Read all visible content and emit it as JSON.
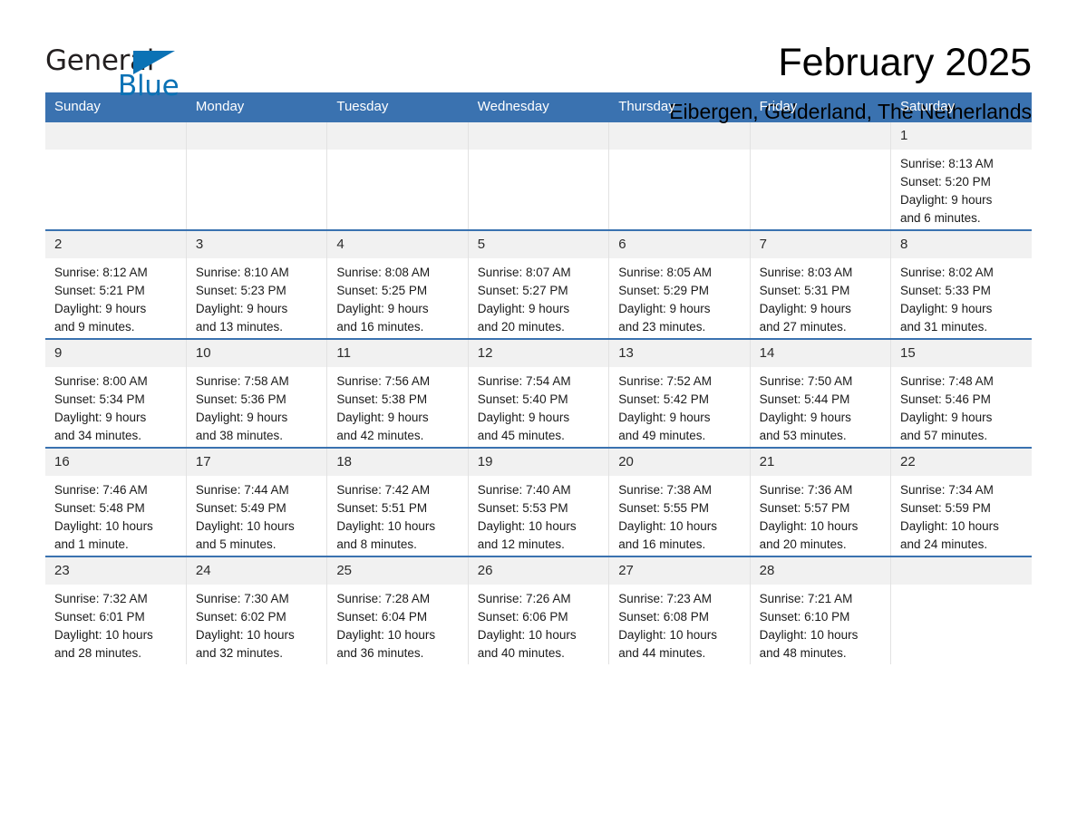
{
  "logo": {
    "word_one": "General",
    "word_two": "Blue",
    "triangle_icon": "triangle-icon",
    "brand_black": "#231f20",
    "brand_blue": "#0b72b5"
  },
  "header": {
    "title": "February 2025",
    "subtitle": "Eibergen, Gelderland, The Netherlands"
  },
  "theme": {
    "header_bg": "#3a72b0",
    "daynum_bg": "#f1f1f1",
    "row_rule": "#3a72b0",
    "cell_divider": "#e2e2e2"
  },
  "calendar": {
    "weekday_headers": [
      "Sunday",
      "Monday",
      "Tuesday",
      "Wednesday",
      "Thursday",
      "Friday",
      "Saturday"
    ],
    "weeks": [
      [
        {
          "day": "",
          "lines": []
        },
        {
          "day": "",
          "lines": []
        },
        {
          "day": "",
          "lines": []
        },
        {
          "day": "",
          "lines": []
        },
        {
          "day": "",
          "lines": []
        },
        {
          "day": "",
          "lines": []
        },
        {
          "day": "1",
          "lines": [
            "Sunrise: 8:13 AM",
            "Sunset: 5:20 PM",
            "Daylight: 9 hours",
            "and 6 minutes."
          ]
        }
      ],
      [
        {
          "day": "2",
          "lines": [
            "Sunrise: 8:12 AM",
            "Sunset: 5:21 PM",
            "Daylight: 9 hours",
            "and 9 minutes."
          ]
        },
        {
          "day": "3",
          "lines": [
            "Sunrise: 8:10 AM",
            "Sunset: 5:23 PM",
            "Daylight: 9 hours",
            "and 13 minutes."
          ]
        },
        {
          "day": "4",
          "lines": [
            "Sunrise: 8:08 AM",
            "Sunset: 5:25 PM",
            "Daylight: 9 hours",
            "and 16 minutes."
          ]
        },
        {
          "day": "5",
          "lines": [
            "Sunrise: 8:07 AM",
            "Sunset: 5:27 PM",
            "Daylight: 9 hours",
            "and 20 minutes."
          ]
        },
        {
          "day": "6",
          "lines": [
            "Sunrise: 8:05 AM",
            "Sunset: 5:29 PM",
            "Daylight: 9 hours",
            "and 23 minutes."
          ]
        },
        {
          "day": "7",
          "lines": [
            "Sunrise: 8:03 AM",
            "Sunset: 5:31 PM",
            "Daylight: 9 hours",
            "and 27 minutes."
          ]
        },
        {
          "day": "8",
          "lines": [
            "Sunrise: 8:02 AM",
            "Sunset: 5:33 PM",
            "Daylight: 9 hours",
            "and 31 minutes."
          ]
        }
      ],
      [
        {
          "day": "9",
          "lines": [
            "Sunrise: 8:00 AM",
            "Sunset: 5:34 PM",
            "Daylight: 9 hours",
            "and 34 minutes."
          ]
        },
        {
          "day": "10",
          "lines": [
            "Sunrise: 7:58 AM",
            "Sunset: 5:36 PM",
            "Daylight: 9 hours",
            "and 38 minutes."
          ]
        },
        {
          "day": "11",
          "lines": [
            "Sunrise: 7:56 AM",
            "Sunset: 5:38 PM",
            "Daylight: 9 hours",
            "and 42 minutes."
          ]
        },
        {
          "day": "12",
          "lines": [
            "Sunrise: 7:54 AM",
            "Sunset: 5:40 PM",
            "Daylight: 9 hours",
            "and 45 minutes."
          ]
        },
        {
          "day": "13",
          "lines": [
            "Sunrise: 7:52 AM",
            "Sunset: 5:42 PM",
            "Daylight: 9 hours",
            "and 49 minutes."
          ]
        },
        {
          "day": "14",
          "lines": [
            "Sunrise: 7:50 AM",
            "Sunset: 5:44 PM",
            "Daylight: 9 hours",
            "and 53 minutes."
          ]
        },
        {
          "day": "15",
          "lines": [
            "Sunrise: 7:48 AM",
            "Sunset: 5:46 PM",
            "Daylight: 9 hours",
            "and 57 minutes."
          ]
        }
      ],
      [
        {
          "day": "16",
          "lines": [
            "Sunrise: 7:46 AM",
            "Sunset: 5:48 PM",
            "Daylight: 10 hours",
            "and 1 minute."
          ]
        },
        {
          "day": "17",
          "lines": [
            "Sunrise: 7:44 AM",
            "Sunset: 5:49 PM",
            "Daylight: 10 hours",
            "and 5 minutes."
          ]
        },
        {
          "day": "18",
          "lines": [
            "Sunrise: 7:42 AM",
            "Sunset: 5:51 PM",
            "Daylight: 10 hours",
            "and 8 minutes."
          ]
        },
        {
          "day": "19",
          "lines": [
            "Sunrise: 7:40 AM",
            "Sunset: 5:53 PM",
            "Daylight: 10 hours",
            "and 12 minutes."
          ]
        },
        {
          "day": "20",
          "lines": [
            "Sunrise: 7:38 AM",
            "Sunset: 5:55 PM",
            "Daylight: 10 hours",
            "and 16 minutes."
          ]
        },
        {
          "day": "21",
          "lines": [
            "Sunrise: 7:36 AM",
            "Sunset: 5:57 PM",
            "Daylight: 10 hours",
            "and 20 minutes."
          ]
        },
        {
          "day": "22",
          "lines": [
            "Sunrise: 7:34 AM",
            "Sunset: 5:59 PM",
            "Daylight: 10 hours",
            "and 24 minutes."
          ]
        }
      ],
      [
        {
          "day": "23",
          "lines": [
            "Sunrise: 7:32 AM",
            "Sunset: 6:01 PM",
            "Daylight: 10 hours",
            "and 28 minutes."
          ]
        },
        {
          "day": "24",
          "lines": [
            "Sunrise: 7:30 AM",
            "Sunset: 6:02 PM",
            "Daylight: 10 hours",
            "and 32 minutes."
          ]
        },
        {
          "day": "25",
          "lines": [
            "Sunrise: 7:28 AM",
            "Sunset: 6:04 PM",
            "Daylight: 10 hours",
            "and 36 minutes."
          ]
        },
        {
          "day": "26",
          "lines": [
            "Sunrise: 7:26 AM",
            "Sunset: 6:06 PM",
            "Daylight: 10 hours",
            "and 40 minutes."
          ]
        },
        {
          "day": "27",
          "lines": [
            "Sunrise: 7:23 AM",
            "Sunset: 6:08 PM",
            "Daylight: 10 hours",
            "and 44 minutes."
          ]
        },
        {
          "day": "28",
          "lines": [
            "Sunrise: 7:21 AM",
            "Sunset: 6:10 PM",
            "Daylight: 10 hours",
            "and 48 minutes."
          ]
        },
        {
          "day": "",
          "lines": []
        }
      ]
    ]
  }
}
